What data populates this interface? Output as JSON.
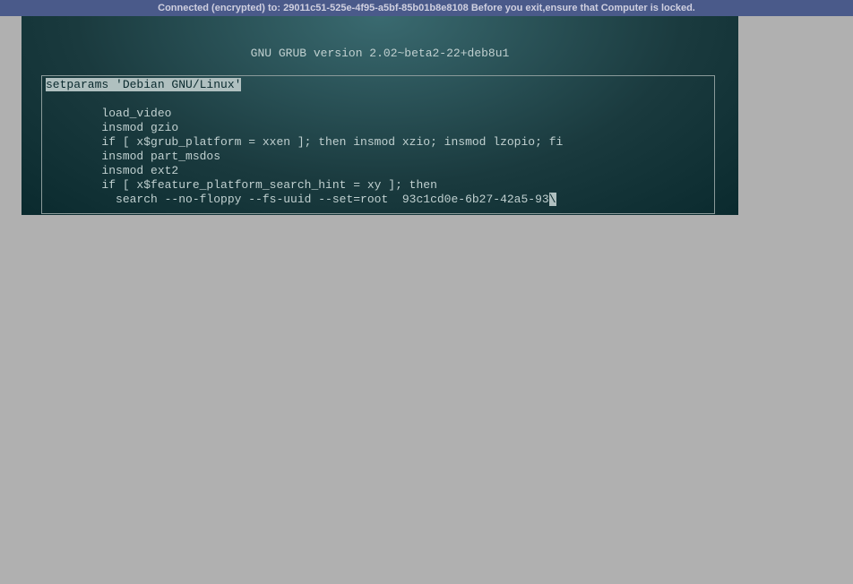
{
  "status_bar": {
    "text": "Connected (encrypted) to: 29011c51-525e-4f95-a5bf-85b01b8e8108 Before you exit,ensure that Computer is locked."
  },
  "grub": {
    "title": "GNU GRUB  version 2.02~beta2-22+deb8u1",
    "lines": {
      "l0": "setparams 'Debian GNU/Linux'",
      "l1": "",
      "l2": "        load_video",
      "l3": "        insmod gzio",
      "l4": "        if [ x$grub_platform = xxen ]; then insmod xzio; insmod lzopio; fi",
      "l5": "        insmod part_msdos",
      "l6": "        insmod ext2",
      "l7": "        if [ x$feature_platform_search_hint = xy ]; then",
      "l8_a": "          search --no-floppy --fs-uuid --set=root  93c1cd0e-6b27-42a5-93",
      "l8_b": "\\"
    }
  }
}
